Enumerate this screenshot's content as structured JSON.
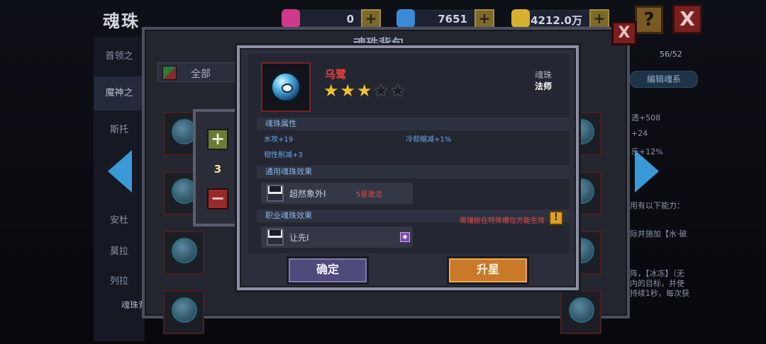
{
  "header": {
    "title": "魂珠",
    "resources": [
      {
        "name": "gem-pink",
        "value": "0",
        "color": "#d03a8a"
      },
      {
        "name": "gem-blue",
        "value": "7651",
        "color": "#3a8ad8"
      },
      {
        "name": "gold",
        "value": "4212.0万",
        "color": "#d8b030"
      }
    ],
    "help_label": "?",
    "close_label": "X"
  },
  "left_nav": {
    "items": [
      "首领之",
      "魔神之",
      "斯托",
      "",
      "安杜",
      "莫拉",
      "列拉"
    ],
    "bag_label": "魂珠背包"
  },
  "bag_panel": {
    "title": "魂珠背包",
    "filter_label": "全部",
    "close_label": "X"
  },
  "right_pane": {
    "count": "56/52",
    "edit_button": "编辑魂系",
    "stats": [
      "透+508",
      "+24",
      "乐+12%"
    ],
    "desc_lines": [
      "用有以下能力：",
      "际并施加【水·破",
      "阵，【冰冻】（无",
      "内的目标，并使",
      "持续1秒，每次获"
    ]
  },
  "quantity": {
    "plus": "+",
    "value": "3",
    "minus": "−"
  },
  "dialog": {
    "orb_name": "乌鹭",
    "stars_filled": 3,
    "stars_total": 5,
    "type_label": "魂珠",
    "class_label": "法师",
    "attr_header": "魂珠属性",
    "attributes": [
      "水攻+19",
      "冷却缩减+1%",
      "韧性削减+3"
    ],
    "common_header": "通用魂珠效果",
    "common_effect": {
      "name": "超然象外Ⅰ",
      "note": "5星激活"
    },
    "job_header": "职业魂珠效果",
    "job_warning": "需镶嵌在特殊槽位方能生效",
    "job_effect": {
      "name": "让先Ⅰ"
    },
    "confirm_button": "确定",
    "upgrade_button": "升星"
  }
}
